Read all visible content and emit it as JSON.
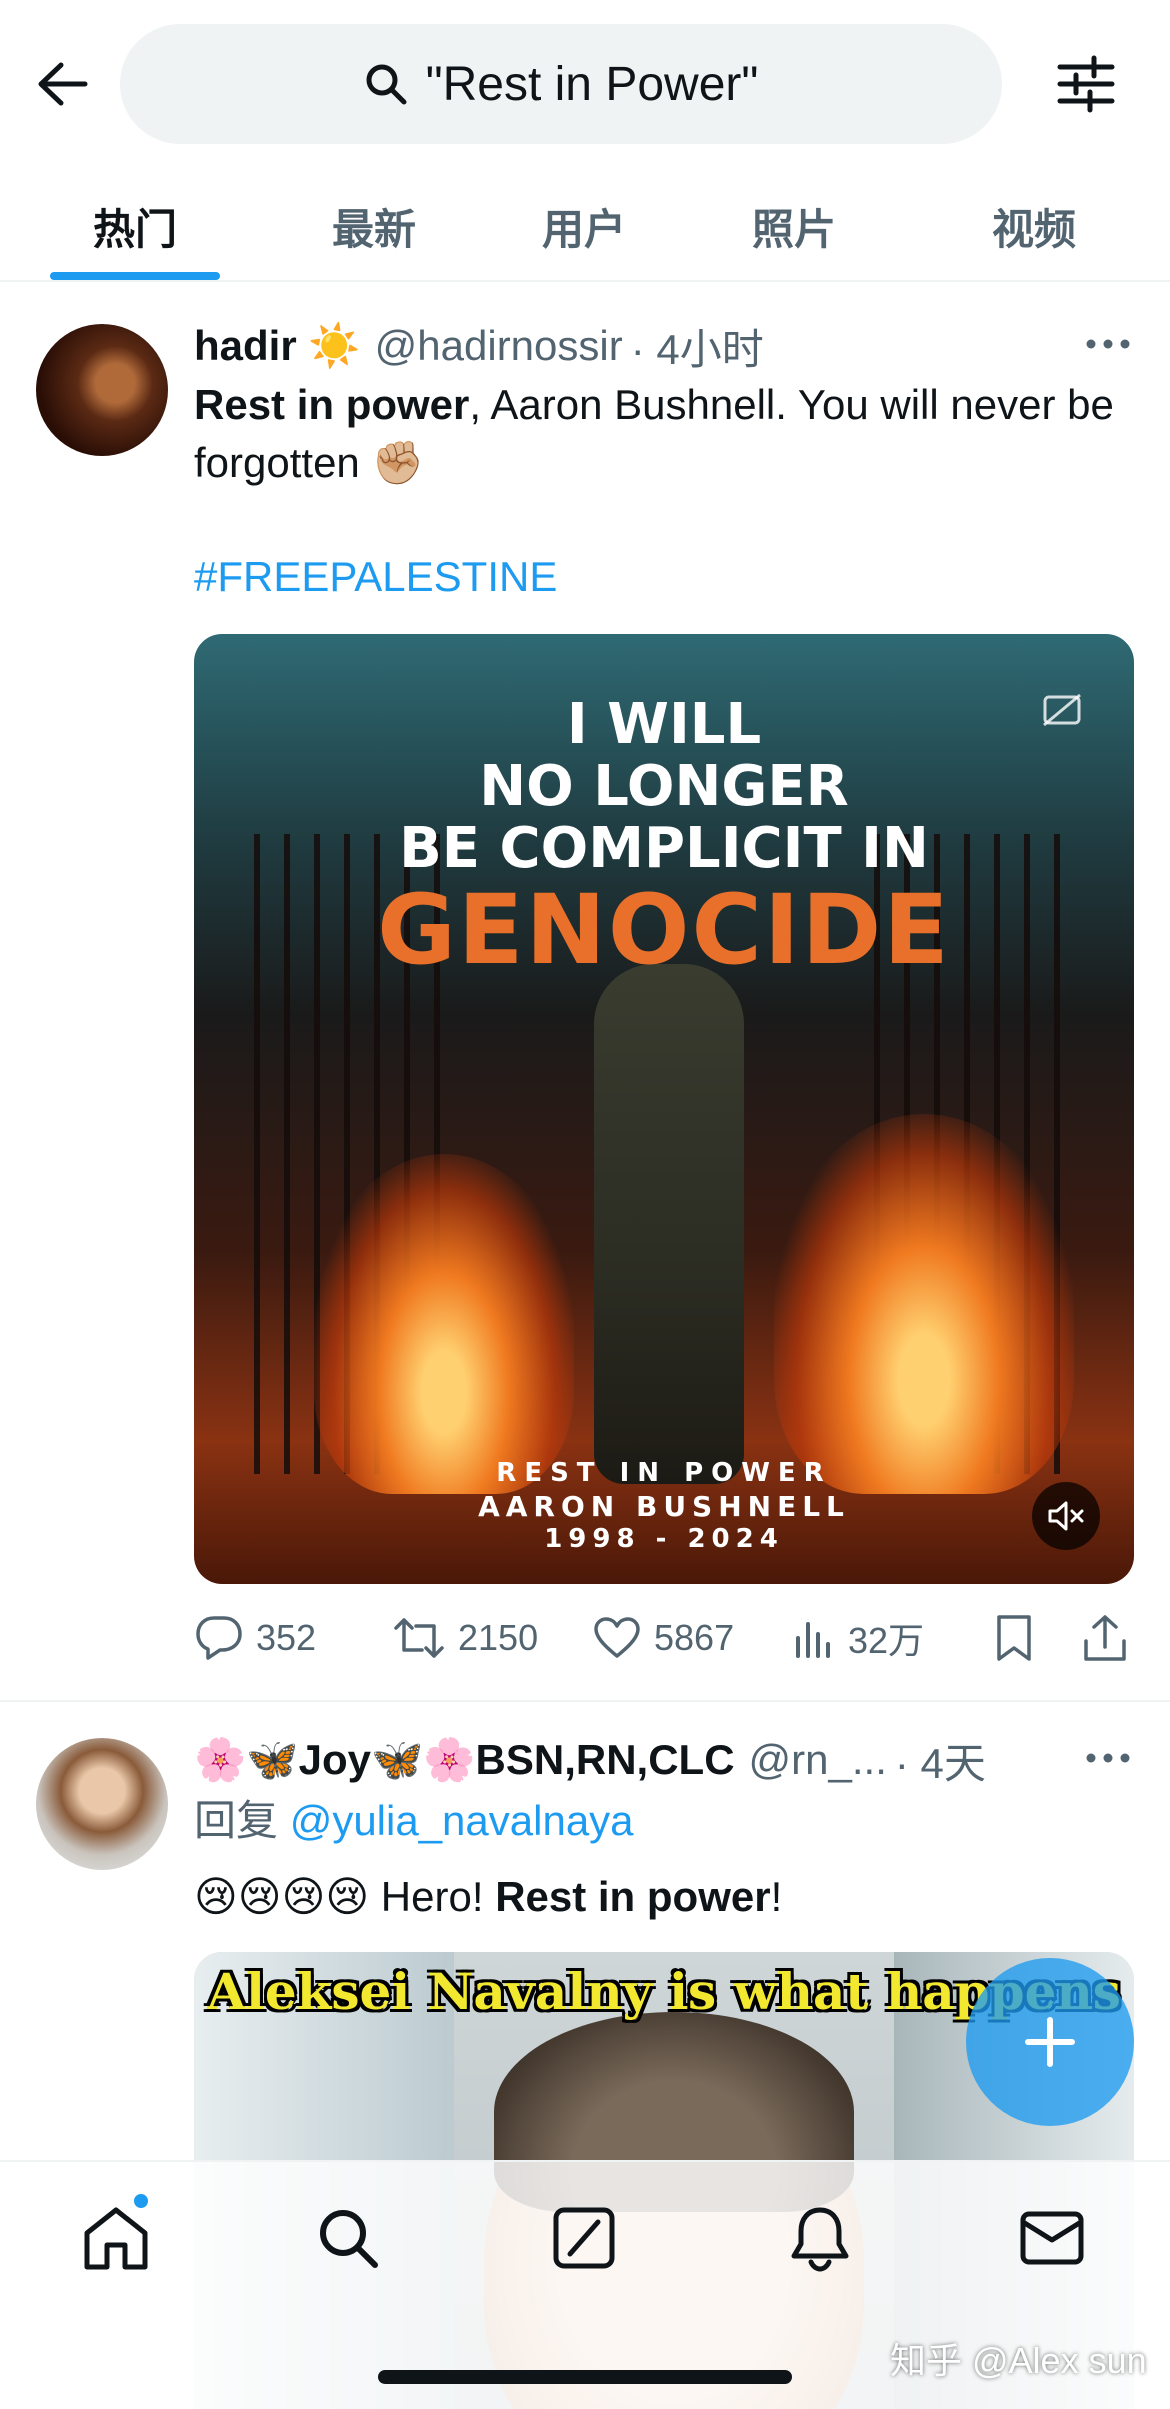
{
  "header": {
    "search_query": "\"Rest in Power\"",
    "tabs": [
      {
        "label": "热门",
        "active": true
      },
      {
        "label": "最新",
        "active": false
      },
      {
        "label": "用户",
        "active": false
      },
      {
        "label": "照片",
        "active": false
      },
      {
        "label": "视频",
        "active": false
      }
    ]
  },
  "tweets": [
    {
      "name": "hadir ☀️",
      "handle": "@hadirnossir",
      "time": "· 4小时",
      "text_bold": "Rest in power",
      "text_rest": ", Aaron Bushnell. You will never be forgotten ✊🏼",
      "hashtag": "#FREEPALESTINE",
      "media_text": {
        "line1": "I WILL",
        "line2": "NO LONGER",
        "line3": "BE COMPLICIT IN",
        "line4": "GENOCIDE",
        "line5": "REST IN POWER",
        "line6": "AARON BUSHNELL",
        "line7": "1998 - 2024"
      },
      "stats": {
        "replies": "352",
        "retweets": "2150",
        "likes": "5867",
        "views": "32万"
      }
    },
    {
      "name": "🌸🦋Joy🦋🌸BSN,RN,CLC",
      "handle": "@rn_...",
      "time": "· 4天",
      "reply_prefix": "回复",
      "reply_to": "@yulia_navalnaya",
      "text_emoji": "😢😢😢😢 Hero! ",
      "text_bold": "Rest in power",
      "text_end": "!",
      "media_caption": "Aleksei Navalny is what happens"
    }
  ],
  "watermark": "知乎 @Alex sun",
  "colors": {
    "accent": "#1d9bf0",
    "text_primary": "#0f1419",
    "text_secondary": "#536471"
  }
}
